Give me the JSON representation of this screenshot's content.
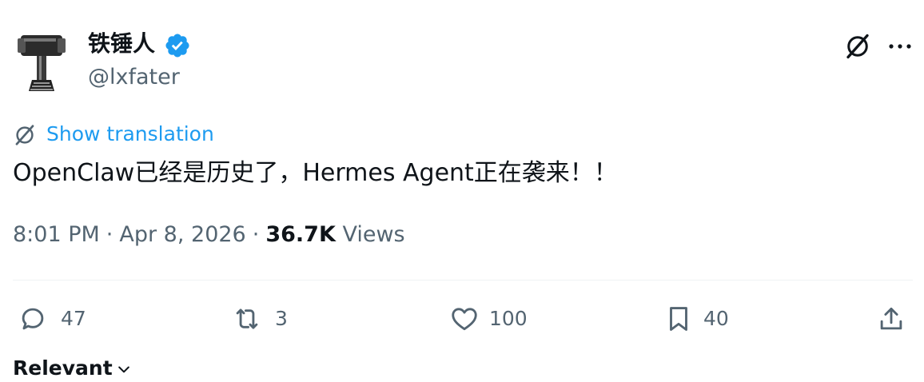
{
  "author": {
    "name": "铁锤人",
    "handle": "@lxfater",
    "verified": true,
    "avatar_icon": "hammer-icon"
  },
  "header_actions": {
    "grok_icon": "grok-icon",
    "more_icon": "more-icon"
  },
  "translation": {
    "label": "Show translation"
  },
  "tweet": {
    "text": "OpenClaw已经是历史了，Hermes Agent正在袭来！！"
  },
  "meta": {
    "time": "8:01 PM",
    "separator": "·",
    "date": "Apr 8, 2026",
    "views_count": "36.7K",
    "views_label": "Views"
  },
  "actions": {
    "replies": "47",
    "reposts": "3",
    "likes": "100",
    "bookmarks": "40"
  },
  "sort": {
    "label": "Relevant"
  },
  "colors": {
    "accent": "#1d9bf0",
    "secondary_text": "#536471",
    "primary_text": "#0f1419"
  }
}
